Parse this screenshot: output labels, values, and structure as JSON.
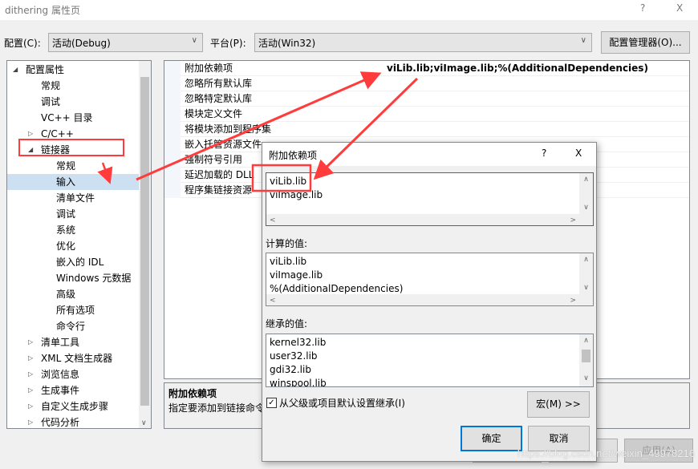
{
  "window": {
    "title": "dithering 属性页",
    "help": "?",
    "close": "X"
  },
  "toolbar": {
    "config_label": "配置(C):",
    "config_value": "活动(Debug)",
    "platform_label": "平台(P):",
    "platform_value": "活动(Win32)",
    "config_manager": "配置管理器(O)..."
  },
  "tree": [
    {
      "label": "配置属性",
      "level": 0,
      "arrow": "◢"
    },
    {
      "label": "常规",
      "level": 1
    },
    {
      "label": "调试",
      "level": 1
    },
    {
      "label": "VC++ 目录",
      "level": 1
    },
    {
      "label": "C/C++",
      "level": 1,
      "arrow": "▷"
    },
    {
      "label": "链接器",
      "level": 1,
      "arrow": "◢"
    },
    {
      "label": "常规",
      "level": 2
    },
    {
      "label": "输入",
      "level": 2,
      "selected": true
    },
    {
      "label": "清单文件",
      "level": 2
    },
    {
      "label": "调试",
      "level": 2
    },
    {
      "label": "系统",
      "level": 2
    },
    {
      "label": "优化",
      "level": 2
    },
    {
      "label": "嵌入的 IDL",
      "level": 2
    },
    {
      "label": "Windows 元数据",
      "level": 2
    },
    {
      "label": "高级",
      "level": 2
    },
    {
      "label": "所有选项",
      "level": 2
    },
    {
      "label": "命令行",
      "level": 2
    },
    {
      "label": "清单工具",
      "level": 1,
      "arrow": "▷"
    },
    {
      "label": "XML 文档生成器",
      "level": 1,
      "arrow": "▷"
    },
    {
      "label": "浏览信息",
      "level": 1,
      "arrow": "▷"
    },
    {
      "label": "生成事件",
      "level": 1,
      "arrow": "▷"
    },
    {
      "label": "自定义生成步骤",
      "level": 1,
      "arrow": "▷"
    },
    {
      "label": "代码分析",
      "level": 1,
      "arrow": "▷"
    }
  ],
  "grid": [
    {
      "name": "附加依赖项",
      "value": "viLib.lib;viImage.lib;%(AdditionalDependencies)"
    },
    {
      "name": "忽略所有默认库",
      "value": ""
    },
    {
      "name": "忽略特定默认库",
      "value": ""
    },
    {
      "name": "模块定义文件",
      "value": ""
    },
    {
      "name": "将模块添加到程序集",
      "value": ""
    },
    {
      "name": "嵌入托管资源文件",
      "value": ""
    },
    {
      "name": "强制符号引用",
      "value": ""
    },
    {
      "name": "延迟加载的 DLL",
      "value": ""
    },
    {
      "name": "程序集链接资源",
      "value": ""
    }
  ],
  "description": {
    "title": "附加依赖项",
    "text": "指定要添加到链接命令行的附加项"
  },
  "footer": {
    "ok": "确定",
    "cancel": "取消",
    "apply": "应用(A)"
  },
  "watermark": "https://blog.csdn.net/weixin_49978216",
  "dialog": {
    "title": "附加依赖项",
    "help": "?",
    "close": "X",
    "edit_lines": [
      "viLib.lib",
      "viImage.lib"
    ],
    "computed_label": "计算的值:",
    "computed_lines": [
      "viLib.lib",
      "viImage.lib",
      "%(AdditionalDependencies)"
    ],
    "inherited_label": "继承的值:",
    "inherited_lines": [
      "kernel32.lib",
      "user32.lib",
      "gdi32.lib",
      "winspool.lib"
    ],
    "inherit_checkbox": "从父级或项目默认设置继承(I)",
    "inherit_checked": true,
    "macro_button": "宏(M) >>",
    "ok": "确定",
    "cancel": "取消"
  },
  "colors": {
    "annotation": "#ff3b3b",
    "selection": "#cde0f2",
    "focus": "#0078d7"
  }
}
